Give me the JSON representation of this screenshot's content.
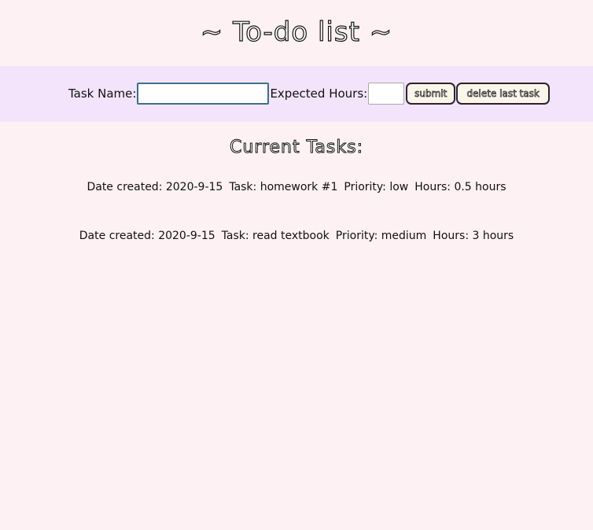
{
  "page": {
    "title": "~ To-do list ~"
  },
  "form": {
    "task_name_label": "Task Name:",
    "task_name_value": "",
    "expected_hours_label": "Expected Hours:",
    "expected_hours_value": "",
    "submit_label": "submit",
    "delete_label": "delete last task"
  },
  "tasks_heading": "Current Tasks:",
  "tasks": [
    {
      "date": "Date created: 2020-9-15",
      "task": "Task: homework #1",
      "priority": "Priority: low",
      "hours": "Hours: 0.5 hours"
    },
    {
      "date": "Date created: 2020-9-15",
      "task": "Task: read textbook",
      "priority": "Priority: medium",
      "hours": "Hours: 3 hours"
    }
  ],
  "colors": {
    "page_background": "#fdf1f3",
    "form_bar_background": "#f3e4fb",
    "input_border": "#3d6f8e",
    "button_background": "#fcf6ea"
  }
}
